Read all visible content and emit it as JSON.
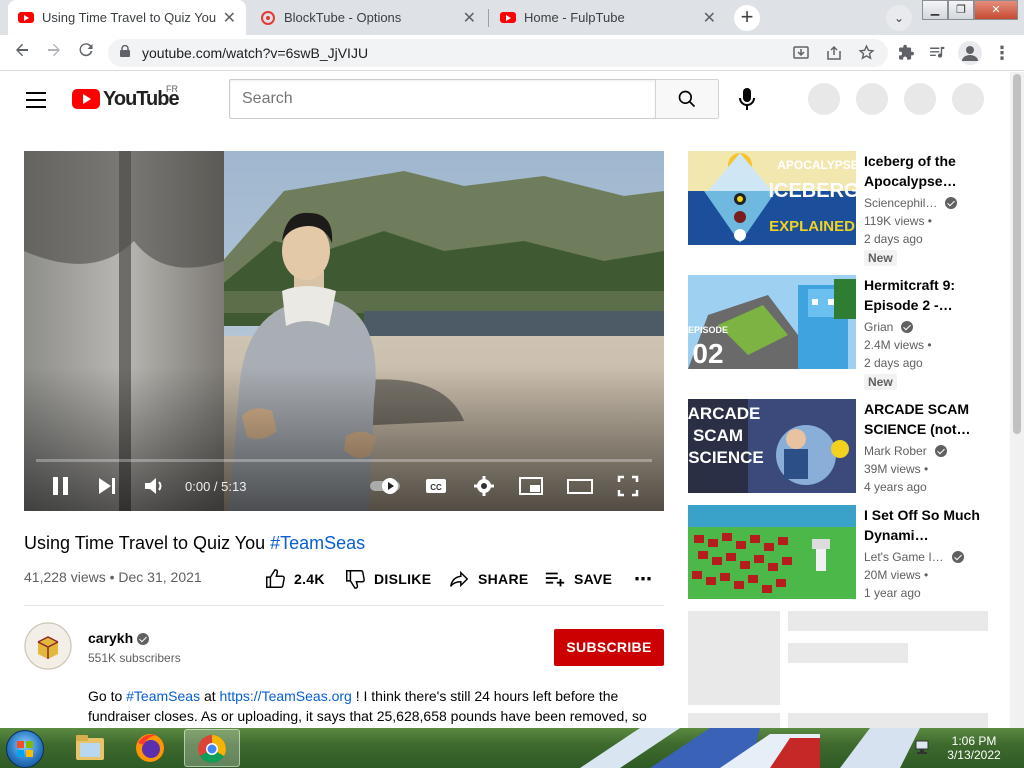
{
  "browser": {
    "tabs": [
      {
        "title": "Using Time Travel to Quiz You #Te",
        "icon": "youtube-icon",
        "active": true
      },
      {
        "title": "BlockTube - Options",
        "icon": "blocktube-icon",
        "active": false
      },
      {
        "title": "Home - FulpTube",
        "icon": "youtube-icon",
        "active": false
      }
    ],
    "url": "youtube.com/watch?v=6swB_JjVIJU"
  },
  "yt_header": {
    "logo": "YouTube",
    "region": "FR",
    "search_placeholder": "Search"
  },
  "video": {
    "time": "0:00 / 5:13",
    "progress": 0.0,
    "title_main": "Using Time Travel to Quiz You ",
    "title_tag": "#TeamSeas",
    "views_date": "41,228 views • Dec 31, 2021",
    "actions": {
      "like": "2.4K",
      "dislike": "DISLIKE",
      "share": "SHARE",
      "save": "SAVE"
    }
  },
  "channel": {
    "name": "carykh",
    "subscribers": "551K subscribers",
    "subscribe_label": "SUBSCRIBE"
  },
  "description": {
    "p1": "Go to ",
    "tag": "#TeamSeas",
    "p2": " at ",
    "link": "https://TeamSeas.org",
    "p3": " ! I think there's still 24 hours left before the fundraiser closes. As or uploading, it says that 25,628,658 pounds have been removed, so"
  },
  "recommendations": [
    {
      "title": "Iceberg of the Apocalypse…",
      "channel": "Sciencephil…",
      "views": "119K views •",
      "age": "2 days ago",
      "badge": "New",
      "thumb_text": [
        "APOCALYPSE",
        "ICEBERG",
        "EXPLAINED"
      ]
    },
    {
      "title": "Hermitcraft 9: Episode 2 -…",
      "channel": "Grian",
      "views": "2.4M views •",
      "age": "2 days ago",
      "badge": "New",
      "thumb_text": [
        "EPISODE",
        "02"
      ]
    },
    {
      "title": "ARCADE SCAM SCIENCE (not…",
      "channel": "Mark Rober",
      "views": "39M views •",
      "age": "4 years ago",
      "badge": "",
      "thumb_text": [
        "ARCADE",
        "SCAM",
        "SCIENCE"
      ]
    },
    {
      "title": "I Set Off So Much Dynami…",
      "channel": "Let's Game I…",
      "views": "20M views •",
      "age": "1 year ago",
      "badge": "",
      "thumb_text": []
    }
  ],
  "taskbar": {
    "time": "1:06 PM",
    "date": "3/13/2022"
  },
  "colors": {
    "brand_red": "#ff0000",
    "subscribe_red": "#cc0000",
    "link_blue": "#065fd4"
  }
}
